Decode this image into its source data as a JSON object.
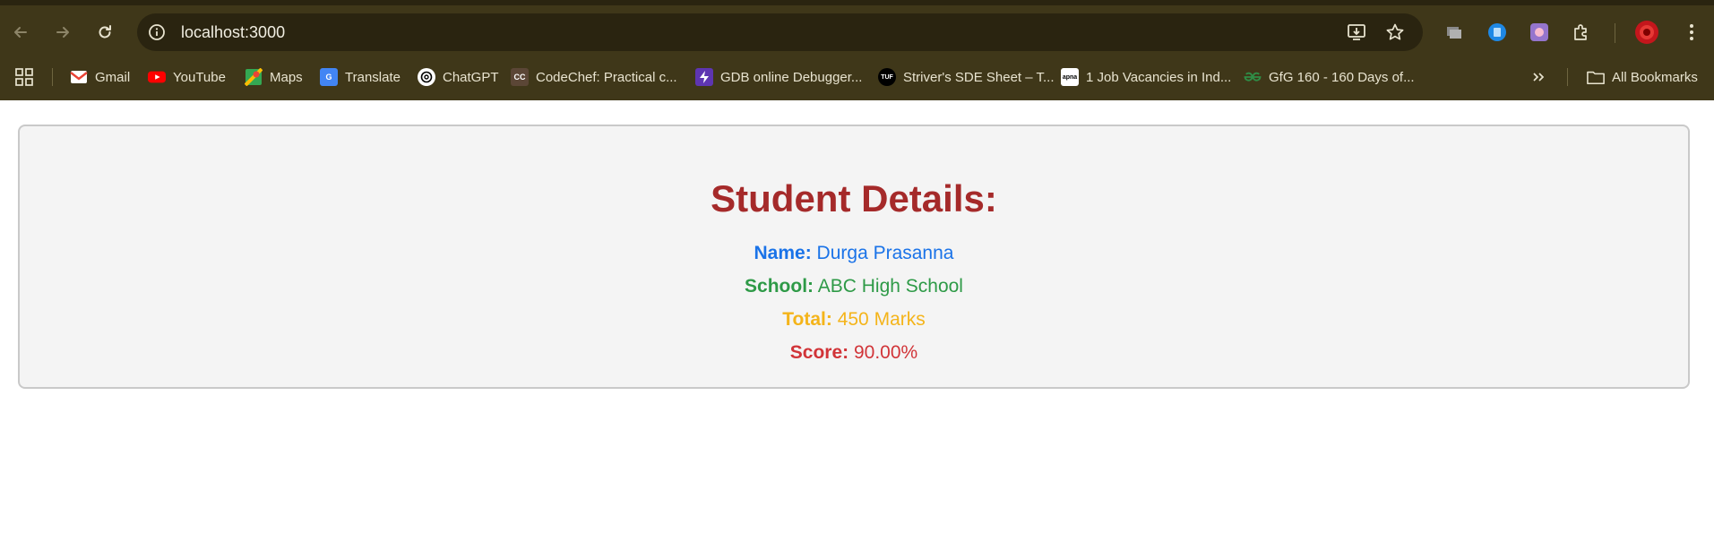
{
  "browser": {
    "url": "localhost:3000",
    "bookmarks": [
      {
        "label": "Gmail",
        "icon": "gmail-icon"
      },
      {
        "label": "YouTube",
        "icon": "youtube-icon"
      },
      {
        "label": "Maps",
        "icon": "maps-icon"
      },
      {
        "label": "Translate",
        "icon": "translate-icon"
      },
      {
        "label": "ChatGPT",
        "icon": "chatgpt-icon"
      },
      {
        "label": "CodeChef: Practical c...",
        "icon": "codechef-icon"
      },
      {
        "label": "GDB online Debugger...",
        "icon": "gdb-icon"
      },
      {
        "label": "Striver's SDE Sheet – T...",
        "icon": "tuf-icon"
      },
      {
        "label": "1 Job Vacancies in Ind...",
        "icon": "apna-icon"
      },
      {
        "label": "GfG 160 - 160 Days of...",
        "icon": "gfg-icon"
      }
    ],
    "all_bookmarks_label": "All Bookmarks",
    "codechef_fav_text": "CC",
    "tuf_fav_text": "TUF",
    "apna_fav_text": "apna"
  },
  "page": {
    "title": "Student Details:",
    "fields": [
      {
        "label": "Name:",
        "value": "Durga Prasanna",
        "color": "#1a73e8"
      },
      {
        "label": "School:",
        "value": "ABC High School",
        "color": "#2e9a47"
      },
      {
        "label": "Total:",
        "value": "450 Marks",
        "color": "#f4b41a"
      },
      {
        "label": "Score:",
        "value": "90.00%",
        "color": "#d13438"
      }
    ],
    "title_color": "#a52a2a"
  }
}
